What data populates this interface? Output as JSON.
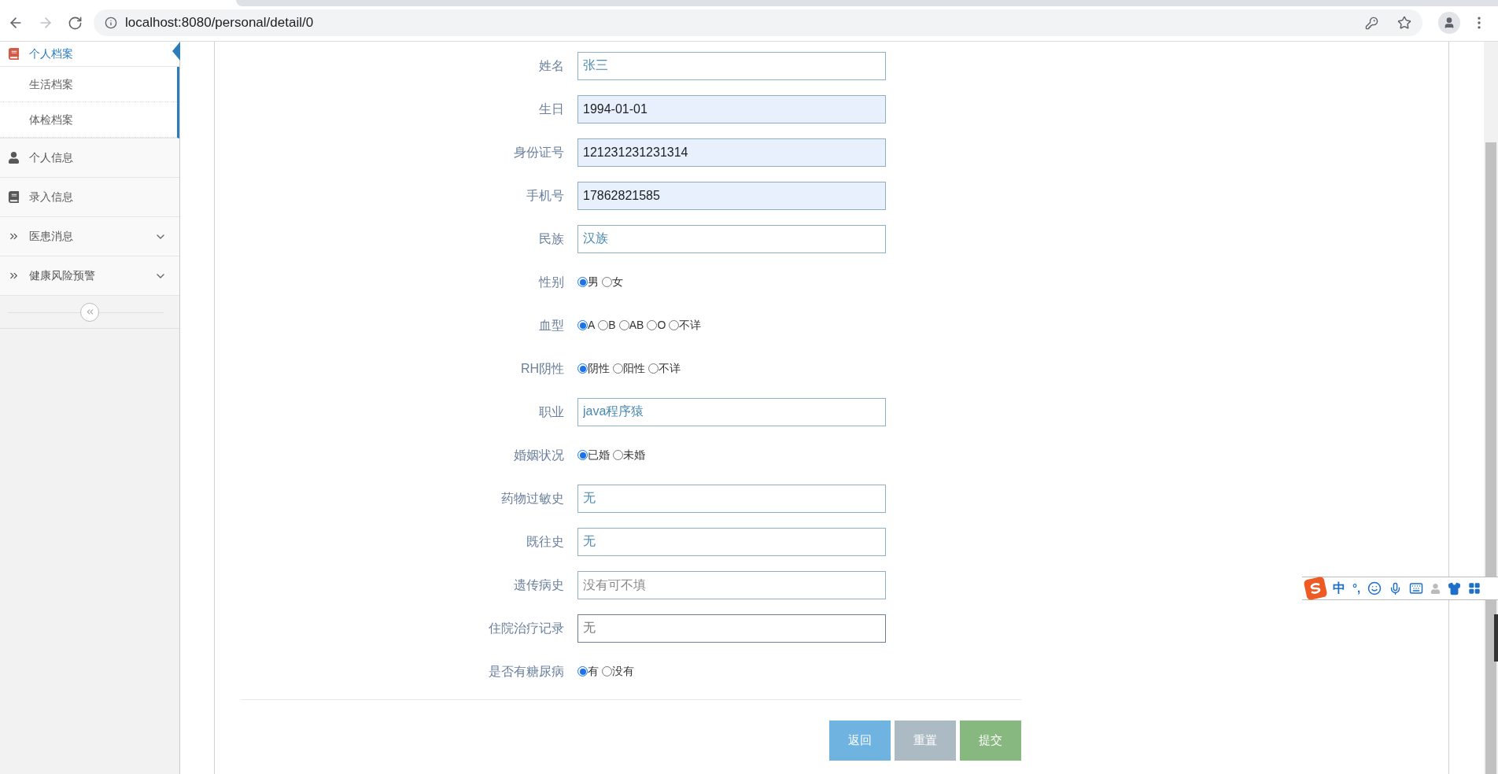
{
  "browser": {
    "url": "localhost:8080/personal/detail/0"
  },
  "sidebar": {
    "items": [
      {
        "label": "个人档案",
        "kind": "book",
        "selected": true,
        "expanded": true,
        "children": [
          {
            "label": "生活档案",
            "selected": false
          },
          {
            "label": "体检档案",
            "selected": false
          }
        ]
      },
      {
        "label": "个人信息",
        "kind": "user",
        "selected": false
      },
      {
        "label": "录入信息",
        "kind": "book",
        "selected": false
      },
      {
        "label": "医患消息",
        "kind": "chevrons",
        "selected": false,
        "dropdown": true
      },
      {
        "label": "健康风险预警",
        "kind": "chevrons",
        "selected": false,
        "dropdown": true
      }
    ]
  },
  "form": {
    "fields": [
      {
        "kind": "text",
        "label": "姓名",
        "value": "张三",
        "autofill": false,
        "focused": false
      },
      {
        "kind": "text",
        "label": "生日",
        "value": "1994-01-01",
        "autofill": true,
        "focused": false
      },
      {
        "kind": "text",
        "label": "身份证号",
        "value": "121231231231314",
        "autofill": true,
        "focused": false
      },
      {
        "kind": "text",
        "label": "手机号",
        "value": "17862821585",
        "autofill": true,
        "focused": false
      },
      {
        "kind": "text",
        "label": "民族",
        "value": "汉族",
        "autofill": false,
        "focused": false
      },
      {
        "kind": "radio",
        "label": "性别",
        "options": [
          {
            "label": "男",
            "selected": true
          },
          {
            "label": "女",
            "selected": false
          }
        ]
      },
      {
        "kind": "radio",
        "label": "血型",
        "options": [
          {
            "label": "A",
            "selected": true
          },
          {
            "label": "B",
            "selected": false
          },
          {
            "label": "AB",
            "selected": false
          },
          {
            "label": "O",
            "selected": false
          },
          {
            "label": "不详",
            "selected": false
          }
        ]
      },
      {
        "kind": "radio",
        "label": "RH阴性",
        "options": [
          {
            "label": "阴性",
            "selected": true
          },
          {
            "label": "阳性",
            "selected": false
          },
          {
            "label": "不详",
            "selected": false
          }
        ]
      },
      {
        "kind": "text",
        "label": "职业",
        "value": "java程序猿",
        "autofill": false,
        "focused": false
      },
      {
        "kind": "radio",
        "label": "婚姻状况",
        "options": [
          {
            "label": "已婚",
            "selected": true
          },
          {
            "label": "未婚",
            "selected": false
          }
        ]
      },
      {
        "kind": "text",
        "label": "药物过敏史",
        "value": "无",
        "autofill": false,
        "focused": false
      },
      {
        "kind": "text",
        "label": "既往史",
        "value": "无",
        "autofill": false,
        "focused": false
      },
      {
        "kind": "text",
        "label": "遗传病史",
        "placeholder": "没有可不填",
        "autofill": false,
        "focused": false
      },
      {
        "kind": "text",
        "label": "住院治疗记录",
        "value": "无",
        "autofill": false,
        "focused": true
      },
      {
        "kind": "radio",
        "label": "是否有糖尿病",
        "options": [
          {
            "label": "有",
            "selected": true
          },
          {
            "label": "没有",
            "selected": false
          }
        ]
      }
    ],
    "buttons": [
      {
        "label": "返回",
        "kind": "back"
      },
      {
        "label": "重置",
        "kind": "reset"
      },
      {
        "label": "提交",
        "kind": "submit"
      }
    ]
  },
  "ime_toolbar": {
    "mode": "中",
    "punctuation": "°,"
  }
}
